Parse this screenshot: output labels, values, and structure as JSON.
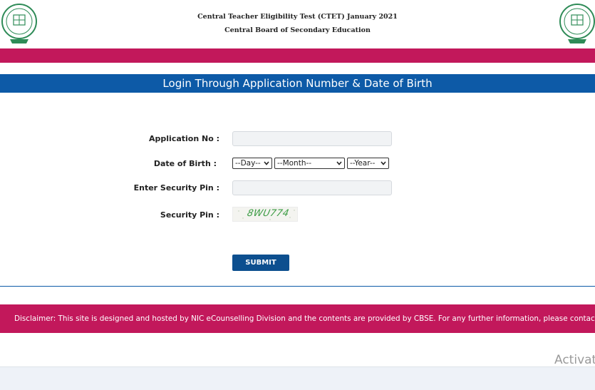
{
  "header": {
    "title": "Central Teacher Eligibility Test (CTET) January 2021",
    "subtitle": "Central Board of Secondary Education"
  },
  "login": {
    "heading": "Login Through Application Number & Date of Birth"
  },
  "form": {
    "application_label": "Application No :",
    "application_value": "",
    "dob_label": "Date of Birth :",
    "day_selected": "--Day--",
    "month_selected": "--Month--",
    "year_selected": "--Year--",
    "pin_input_label": "Enter Security Pin :",
    "pin_input_value": "",
    "security_pin_label": "Security Pin :",
    "security_pin_captcha": "8WU774",
    "submit_label": "SUBMIT"
  },
  "disclaimer": "Disclaimer: This site is designed and hosted by NIC eCounselling Division and the contents are provided by CBSE. For any further information, please contact CBSE",
  "watermark": "Activat",
  "colors": {
    "brand_magenta": "#c2185b",
    "brand_blue": "#0d5aa7",
    "button_blue": "#0d4f8f",
    "captcha_green": "#3c9c44"
  },
  "icons": {
    "logo": "cbse-emblem-icon",
    "dropdown": "chevron-down-icon"
  }
}
